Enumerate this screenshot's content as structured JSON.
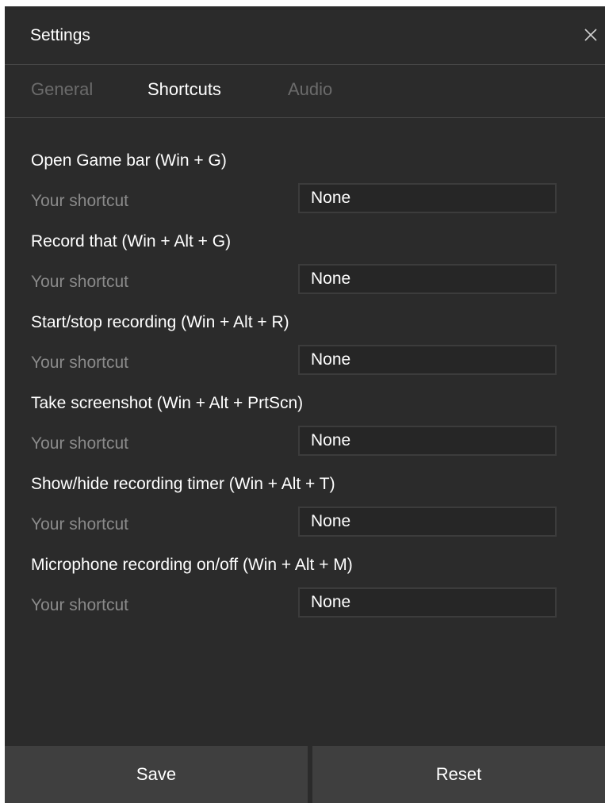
{
  "window": {
    "title": "Settings",
    "close_icon": "close-icon"
  },
  "tabs": [
    {
      "label": "General",
      "active": false
    },
    {
      "label": "Shortcuts",
      "active": true
    },
    {
      "label": "Audio",
      "active": false
    }
  ],
  "shortcuts": [
    {
      "action": "Open Game bar (Win + G)",
      "label": "Your shortcut",
      "value": "None"
    },
    {
      "action": "Record that (Win + Alt + G)",
      "label": "Your shortcut",
      "value": "None"
    },
    {
      "action": "Start/stop recording (Win + Alt + R)",
      "label": "Your shortcut",
      "value": "None"
    },
    {
      "action": "Take screenshot (Win + Alt + PrtScn)",
      "label": "Your shortcut",
      "value": "None"
    },
    {
      "action": "Show/hide recording timer (Win + Alt + T)",
      "label": "Your shortcut",
      "value": "None"
    },
    {
      "action": "Microphone recording on/off (Win + Alt + M)",
      "label": "Your shortcut",
      "value": "None"
    }
  ],
  "footer": {
    "save_label": "Save",
    "reset_label": "Reset"
  },
  "colors": {
    "background": "#2b2b2b",
    "button": "#3f3f3f",
    "text": "#ffffff",
    "muted_text": "#8a8a8a",
    "inactive_tab": "#6b6b6b"
  }
}
